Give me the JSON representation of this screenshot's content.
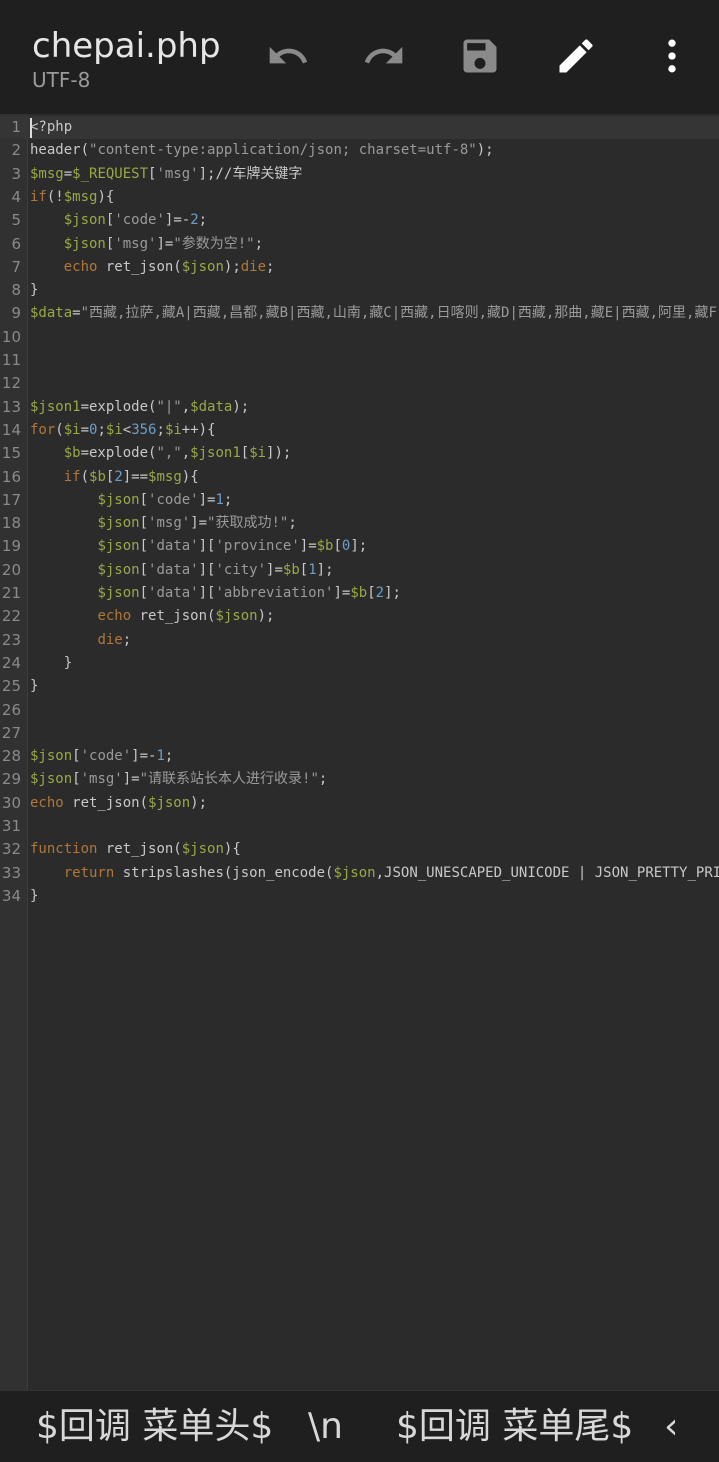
{
  "header": {
    "filename": "chepai.php",
    "encoding": "UTF-8",
    "actions": [
      "undo",
      "redo",
      "save",
      "edit",
      "more"
    ]
  },
  "editor": {
    "lines": [
      {
        "n": "1",
        "text": "<?php"
      },
      {
        "n": "2",
        "text": "header(\"content-type:application/json; charset=utf-8\");"
      },
      {
        "n": "3",
        "text": "$msg=$_REQUEST['msg'];//车牌关键字"
      },
      {
        "n": "4",
        "text": "if(!$msg){"
      },
      {
        "n": "5",
        "text": "    $json['code']=-2;"
      },
      {
        "n": "6",
        "text": "    $json['msg']=\"参数为空!\";"
      },
      {
        "n": "7",
        "text": "    echo ret_json($json);die;"
      },
      {
        "n": "8",
        "text": "}"
      },
      {
        "n": "9",
        "text": "$data=\"西藏,拉萨,藏A|西藏,昌都,藏B|西藏,山南,藏C|西藏,日喀则,藏D|西藏,那曲,藏E|西藏,阿里,藏F|西藏,林芝,藏G|"
      },
      {
        "n": "10",
        "text": ""
      },
      {
        "n": "11",
        "text": ""
      },
      {
        "n": "12",
        "text": ""
      },
      {
        "n": "13",
        "text": "$json1=explode(\"|\",$data);"
      },
      {
        "n": "14",
        "text": "for($i=0;$i<356;$i++){"
      },
      {
        "n": "15",
        "text": "    $b=explode(\",\",$json1[$i]);"
      },
      {
        "n": "16",
        "text": "    if($b[2]==$msg){"
      },
      {
        "n": "17",
        "text": "        $json['code']=1;"
      },
      {
        "n": "18",
        "text": "        $json['msg']=\"获取成功!\";"
      },
      {
        "n": "19",
        "text": "        $json['data']['province']=$b[0];"
      },
      {
        "n": "20",
        "text": "        $json['data']['city']=$b[1];"
      },
      {
        "n": "21",
        "text": "        $json['data']['abbreviation']=$b[2];"
      },
      {
        "n": "22",
        "text": "        echo ret_json($json);"
      },
      {
        "n": "23",
        "text": "        die;"
      },
      {
        "n": "24",
        "text": "    }"
      },
      {
        "n": "25",
        "text": "}"
      },
      {
        "n": "26",
        "text": ""
      },
      {
        "n": "27",
        "text": ""
      },
      {
        "n": "28",
        "text": "$json['code']=-1;"
      },
      {
        "n": "29",
        "text": "$json['msg']=\"请联系站长本人进行收录!\";"
      },
      {
        "n": "30",
        "text": "echo ret_json($json);"
      },
      {
        "n": "31",
        "text": ""
      },
      {
        "n": "32",
        "text": "function ret_json($json){"
      },
      {
        "n": "33",
        "text": "    return stripslashes(json_encode($json,JSON_UNESCAPED_UNICODE | JSON_PRETTY_PRINT | JSON_UNESCAPED_"
      },
      {
        "n": "34",
        "text": "}"
      }
    ]
  },
  "bottom_bar": {
    "items": [
      "$回调 菜单头$",
      "\\n",
      "$回调 菜单尾$",
      "‹"
    ]
  },
  "colors": {
    "background": "#2b2b2b",
    "toolbar": "#1f1f1f",
    "variable": "#9aa846",
    "string": "#9a9a9a",
    "keyword": "#b07838",
    "number": "#6a9fc9",
    "default": "#c8c8c8"
  }
}
